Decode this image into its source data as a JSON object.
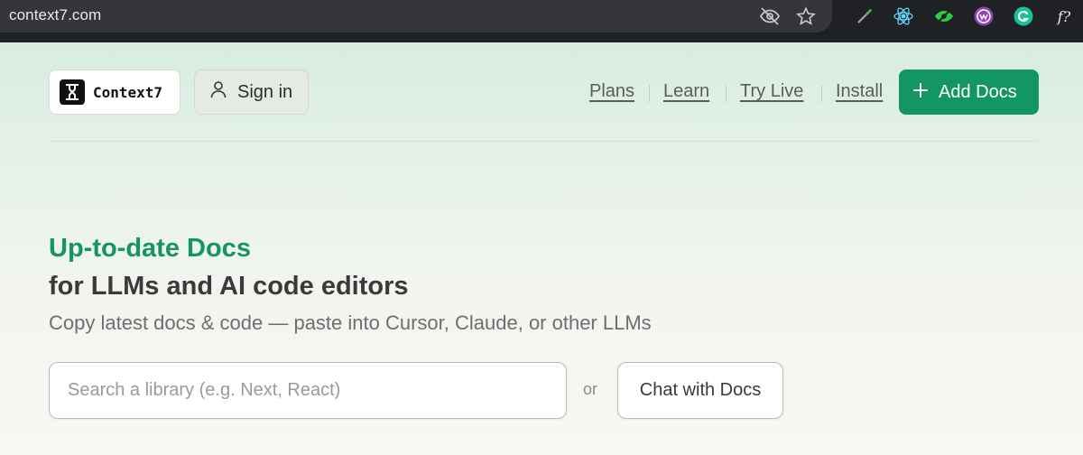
{
  "browser": {
    "url": "context7.com",
    "omnibox_icons": [
      "eye-off-icon",
      "star-icon"
    ],
    "extensions": [
      "color-picker-extension-icon",
      "react-devtools-icon",
      "eye-extension-icon",
      "purple-extension-icon",
      "grammarly-icon",
      "formula-extension-icon"
    ],
    "formula_extension_label": "f?"
  },
  "header": {
    "logo_text": "Context7",
    "signin_label": "Sign in",
    "nav": [
      {
        "label": "Plans"
      },
      {
        "label": "Learn"
      },
      {
        "label": "Try Live"
      },
      {
        "label": "Install"
      }
    ],
    "add_docs_label": "Add Docs"
  },
  "hero": {
    "title": "Up-to-date Docs",
    "subtitle": "for LLMs and AI code editors",
    "description": "Copy latest docs & code — paste into Cursor, Claude, or other LLMs"
  },
  "search": {
    "placeholder": "Search a library (e.g. Next, React)",
    "or_label": "or",
    "chat_label": "Chat with Docs"
  },
  "colors": {
    "accent": "#139564",
    "chrome_bg": "#202124"
  }
}
